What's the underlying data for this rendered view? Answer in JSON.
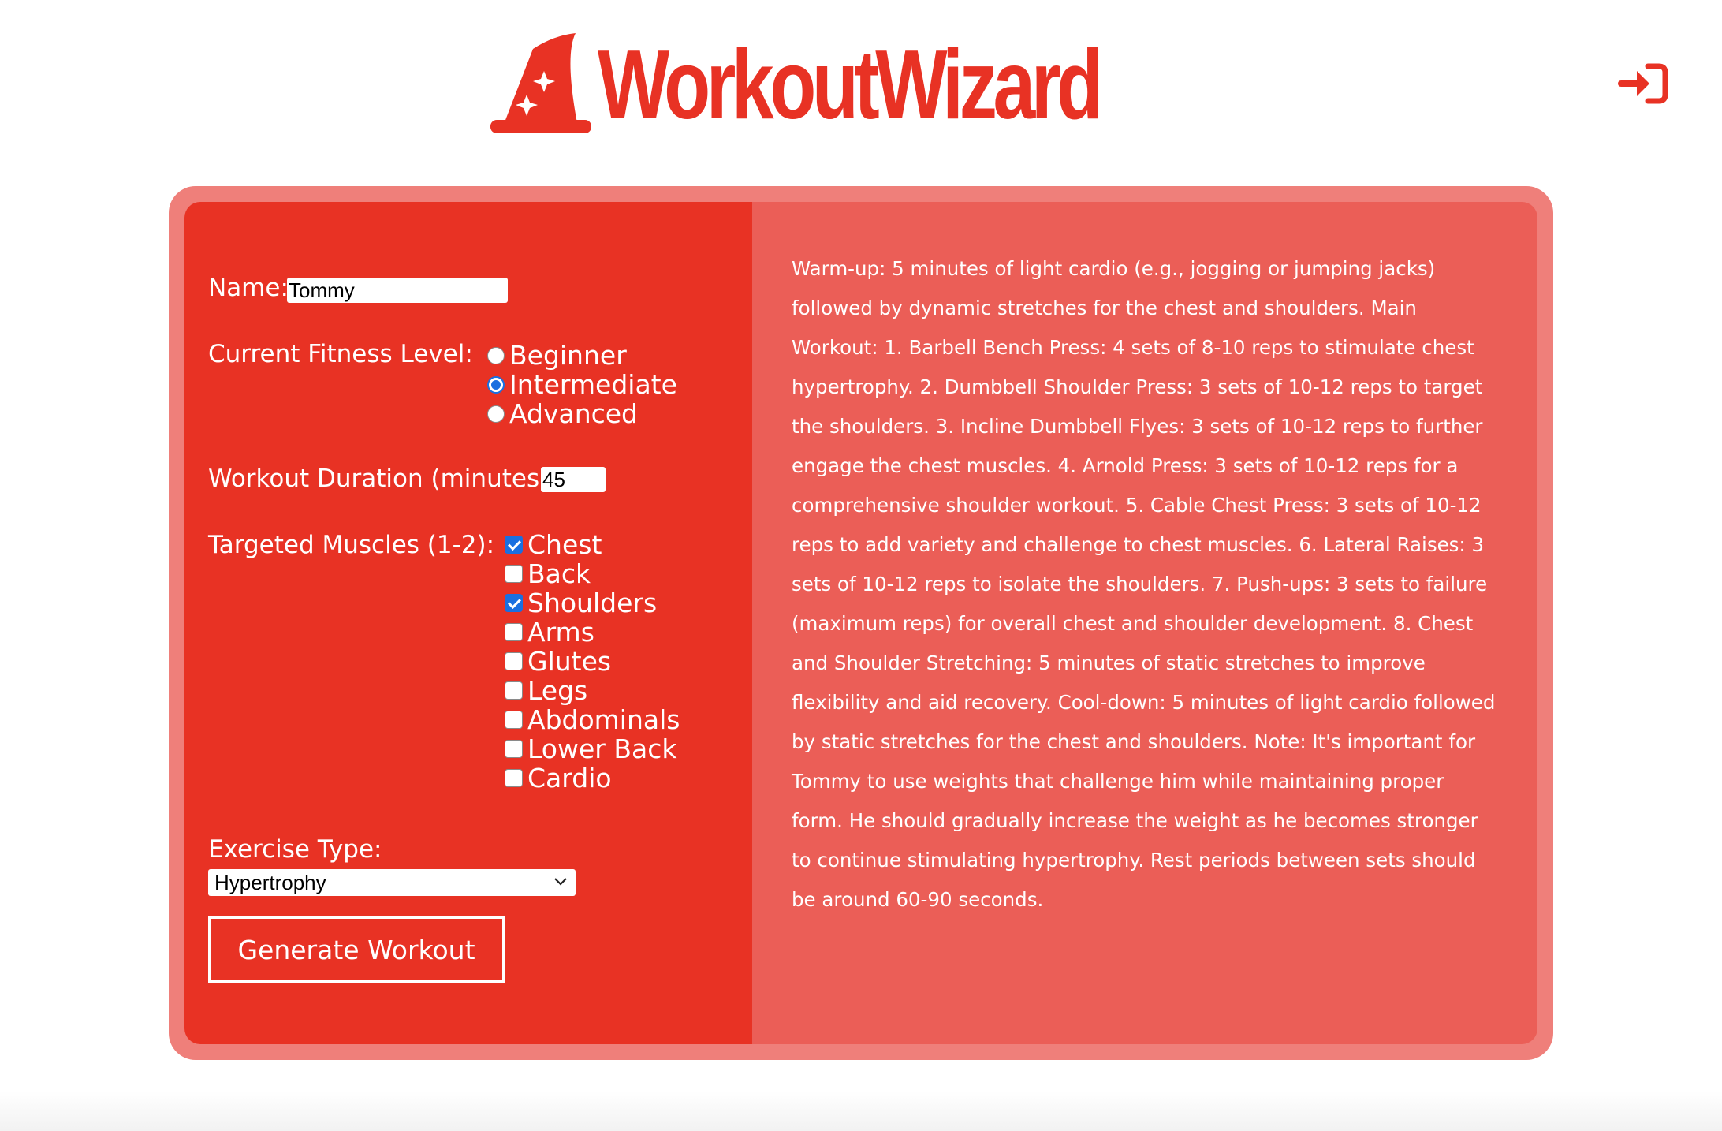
{
  "brand": {
    "name": "WorkoutWizard",
    "color": "#e83224"
  },
  "header": {
    "login_icon": "sign-in-icon"
  },
  "form": {
    "name_label": "Name:",
    "name_value": "Tommy",
    "fitness_label": "Current Fitness Level:",
    "fitness_options": [
      {
        "label": "Beginner",
        "selected": false
      },
      {
        "label": "Intermediate",
        "selected": true
      },
      {
        "label": "Advanced",
        "selected": false
      }
    ],
    "duration_label": "Workout Duration (minutes):",
    "duration_value": "45",
    "muscles_label": "Targeted Muscles (1-2):",
    "muscles": [
      {
        "label": "Chest",
        "checked": true
      },
      {
        "label": "Back",
        "checked": false
      },
      {
        "label": "Shoulders",
        "checked": true
      },
      {
        "label": "Arms",
        "checked": false
      },
      {
        "label": "Glutes",
        "checked": false
      },
      {
        "label": "Legs",
        "checked": false
      },
      {
        "label": "Abdominals",
        "checked": false
      },
      {
        "label": "Lower Back",
        "checked": false
      },
      {
        "label": "Cardio",
        "checked": false
      }
    ],
    "exercise_type_label": "Exercise Type:",
    "exercise_type_value": "Hypertrophy",
    "generate_button": "Generate Workout"
  },
  "result": {
    "text": "Warm-up: 5 minutes of light cardio (e.g., jogging or jumping jacks) followed by dynamic stretches for the chest and shoulders. Main Workout: 1. Barbell Bench Press: 4 sets of 8-10 reps to stimulate chest hypertrophy. 2. Dumbbell Shoulder Press: 3 sets of 10-12 reps to target the shoulders. 3. Incline Dumbbell Flyes: 3 sets of 10-12 reps to further engage the chest muscles. 4. Arnold Press: 3 sets of 10-12 reps for a comprehensive shoulder workout. 5. Cable Chest Press: 3 sets of 10-12 reps to add variety and challenge to chest muscles. 6. Lateral Raises: 3 sets of 10-12 reps to isolate the shoulders. 7. Push-ups: 3 sets to failure (maximum reps) for overall chest and shoulder development. 8. Chest and Shoulder Stretching: 5 minutes of static stretches to improve flexibility and aid recovery. Cool-down: 5 minutes of light cardio followed by static stretches for the chest and shoulders. Note: It's important for Tommy to use weights that challenge him while maintaining proper form. He should gradually increase the weight as he becomes stronger to continue stimulating hypertrophy. Rest periods between sets should be around 60-90 seconds."
  }
}
